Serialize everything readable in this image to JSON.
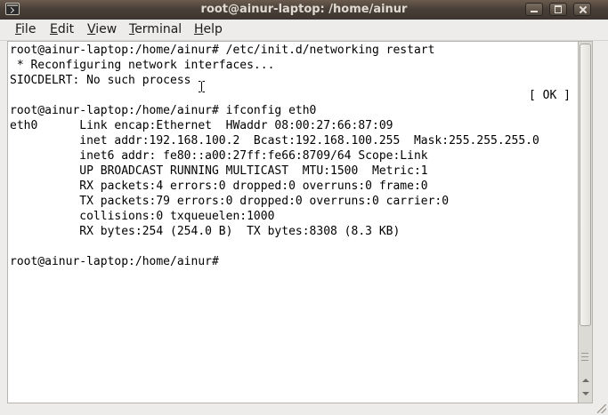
{
  "window": {
    "title": "root@ainur-laptop: /home/ainur",
    "buttons": [
      "minimize-icon",
      "maximize-icon",
      "close-icon"
    ]
  },
  "menu": {
    "items": [
      {
        "mnemonic": "F",
        "rest": "ile"
      },
      {
        "mnemonic": "E",
        "rest": "dit"
      },
      {
        "mnemonic": "V",
        "rest": "iew"
      },
      {
        "mnemonic": "T",
        "rest": "erminal"
      },
      {
        "mnemonic": "H",
        "rest": "elp"
      }
    ]
  },
  "terminal": {
    "lines": [
      "root@ainur-laptop:/home/ainur# /etc/init.d/networking restart",
      " * Reconfiguring network interfaces...",
      "SIOCDELRT: No such process",
      "",
      "root@ainur-laptop:/home/ainur# ifconfig eth0",
      "eth0      Link encap:Ethernet  HWaddr 08:00:27:66:87:09  ",
      "          inet addr:192.168.100.2  Bcast:192.168.100.255  Mask:255.255.255.0",
      "          inet6 addr: fe80::a00:27ff:fe66:8709/64 Scope:Link",
      "          UP BROADCAST RUNNING MULTICAST  MTU:1500  Metric:1",
      "          RX packets:4 errors:0 dropped:0 overruns:0 frame:0",
      "          TX packets:79 errors:0 dropped:0 overruns:0 carrier:0",
      "          collisions:0 txqueuelen:1000 ",
      "          RX bytes:254 (254.0 B)  TX bytes:8308 (8.3 KB)",
      "",
      "root@ainur-laptop:/home/ainur# "
    ],
    "ok_status": "[ OK ]",
    "cursor_icon": "text-ibeam-cursor-icon"
  }
}
